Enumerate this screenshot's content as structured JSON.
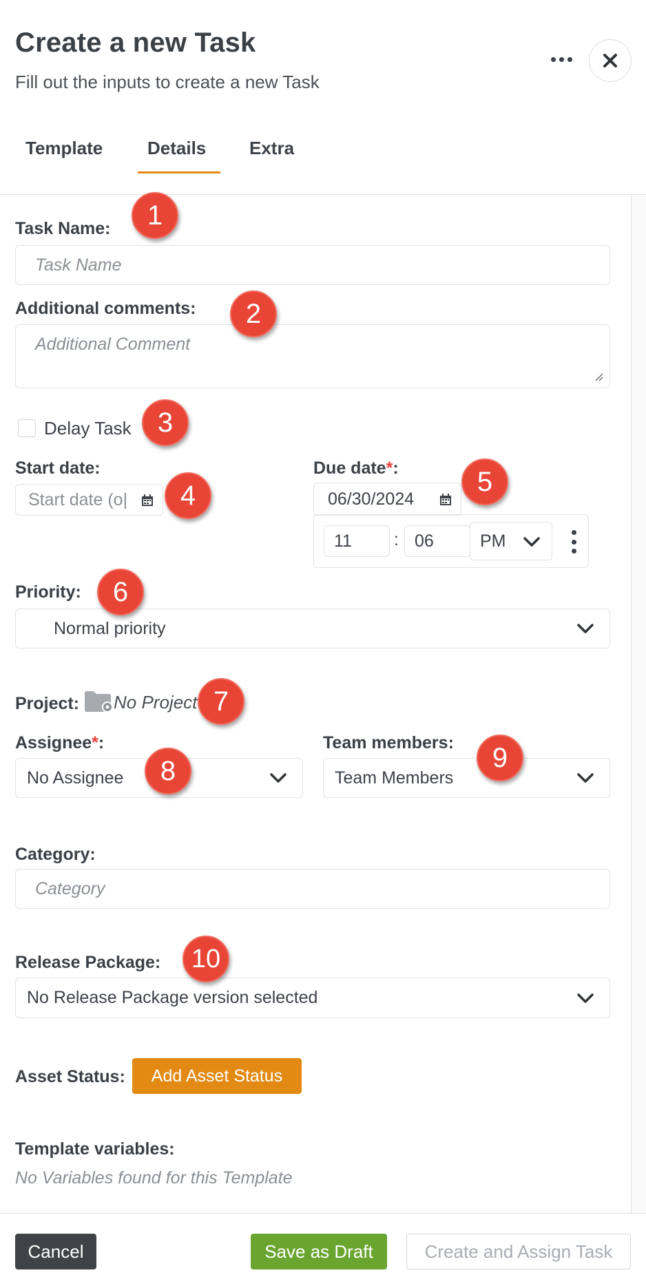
{
  "header": {
    "title": "Create a new Task",
    "subtitle": "Fill out the inputs to create a new Task"
  },
  "tabs": [
    {
      "label": "Template"
    },
    {
      "label": "Details",
      "active": true
    },
    {
      "label": "Extra"
    }
  ],
  "form": {
    "task_name": {
      "label": "Task Name:",
      "placeholder": "Task Name"
    },
    "comments": {
      "label": "Additional comments:",
      "placeholder": "Additional Comment"
    },
    "delay": {
      "label": "Delay Task",
      "checked": false
    },
    "start_date": {
      "label": "Start date:",
      "placeholder": "Start date (o|"
    },
    "due_date": {
      "label": "Due date",
      "required_mark": "*",
      "label_suffix": ":",
      "value": "06/30/2024",
      "hour": "11",
      "separator": ":",
      "minute": "06",
      "ampm": "PM"
    },
    "priority": {
      "label": "Priority:",
      "value": "Normal priority"
    },
    "project": {
      "label": "Project:",
      "value": "No Project"
    },
    "assignee": {
      "label": "Assignee",
      "required_mark": "*",
      "label_suffix": ":",
      "value": "No Assignee"
    },
    "team_members": {
      "label": "Team members:",
      "value": "Team Members"
    },
    "category": {
      "label": "Category:",
      "placeholder": "Category"
    },
    "release_package": {
      "label": "Release Package:",
      "value": "No Release Package version selected"
    },
    "asset_status": {
      "label": "Asset Status:",
      "button": "Add Asset Status"
    },
    "template_variables": {
      "label": "Template variables:",
      "empty_text": "No Variables found for this Template"
    }
  },
  "badges": [
    "1",
    "2",
    "3",
    "4",
    "5",
    "6",
    "7",
    "8",
    "9",
    "10"
  ],
  "footer": {
    "cancel": "Cancel",
    "save_draft": "Save as Draft",
    "create": "Create and Assign Task"
  },
  "colors": {
    "accent": "#e28a14",
    "draft_green": "#6aa530",
    "badge_red": "#e84537",
    "required_red": "#e8403a"
  },
  "icons": [
    "more-icon",
    "close-icon",
    "calendar-icon",
    "chevron-down-icon",
    "kebab-icon",
    "folder-gear-icon"
  ]
}
